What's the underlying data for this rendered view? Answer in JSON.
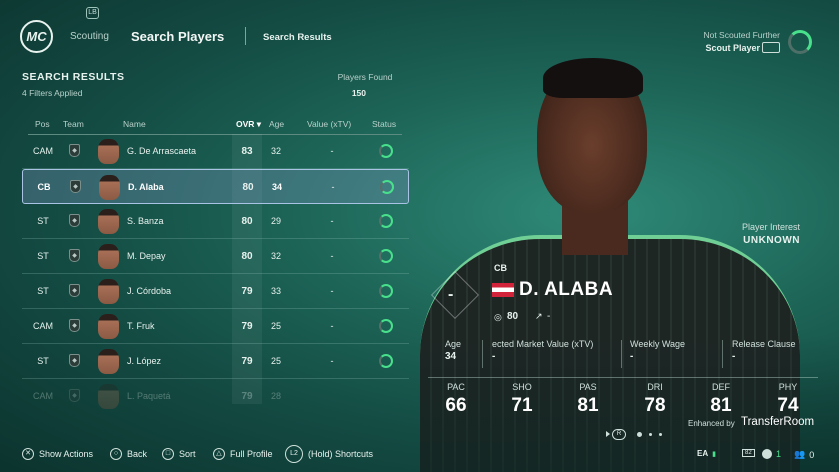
{
  "header": {
    "logo": "MC",
    "lb_badge": "LB",
    "nav_scouting": "Scouting",
    "nav_search_players": "Search Players",
    "nav_search_results": "Search Results",
    "not_scouted": "Not Scouted Further",
    "scout_player": "Scout Player"
  },
  "results": {
    "title": "SEARCH RESULTS",
    "filters": "4 Filters Applied",
    "players_found_label": "Players Found",
    "players_found_value": "150"
  },
  "columns": {
    "pos": "Pos",
    "team": "Team",
    "name": "Name",
    "ovr": "OVR ▾",
    "age": "Age",
    "value": "Value (xTV)",
    "status": "Status"
  },
  "rows": [
    {
      "pos": "CAM",
      "name": "G. De Arrascaeta",
      "ovr": "83",
      "age": "32",
      "value": "-"
    },
    {
      "pos": "CB",
      "name": "D. Alaba",
      "ovr": "80",
      "age": "34",
      "value": "-"
    },
    {
      "pos": "ST",
      "name": "S. Banza",
      "ovr": "80",
      "age": "29",
      "value": "-"
    },
    {
      "pos": "ST",
      "name": "M. Depay",
      "ovr": "80",
      "age": "32",
      "value": "-"
    },
    {
      "pos": "ST",
      "name": "J. Córdoba",
      "ovr": "79",
      "age": "33",
      "value": "-"
    },
    {
      "pos": "CAM",
      "name": "T. Fruk",
      "ovr": "79",
      "age": "25",
      "value": "-"
    },
    {
      "pos": "ST",
      "name": "J. López",
      "ovr": "79",
      "age": "25",
      "value": "-"
    },
    {
      "pos": "CAM",
      "name": "L. Paquetá",
      "ovr": "79",
      "age": "28",
      "value": "-"
    }
  ],
  "player": {
    "interest_label": "Player Interest",
    "interest_value": "UNKNOWN",
    "dash": "-",
    "position": "CB",
    "name": "D. ALABA",
    "ovr": "80",
    "trend": "-",
    "age_label": "Age",
    "age_value": "34",
    "market_label": "ected Market Value (xTV)",
    "market_value": "-",
    "wage_label": "Weekly Wage",
    "wage_value": "-",
    "release_label": "Release Clause",
    "release_value": "-",
    "stats": [
      {
        "label": "PAC",
        "value": "66"
      },
      {
        "label": "SHO",
        "value": "71"
      },
      {
        "label": "PAS",
        "value": "81"
      },
      {
        "label": "DRI",
        "value": "78"
      },
      {
        "label": "DEF",
        "value": "81"
      },
      {
        "label": "PHY",
        "value": "74"
      }
    ],
    "enhanced_by": "Enhanced by",
    "transferroom": "TransferRoom",
    "pager_current": "R"
  },
  "footer": {
    "show_actions": "Show Actions",
    "back": "Back",
    "sort": "Sort",
    "full_profile": "Full Profile",
    "shortcuts": "(Hold) Shortcuts",
    "ea_count": "1",
    "notif_count": "0"
  },
  "colors": {
    "accent_green": "#49e08c",
    "background": "#1d6557"
  }
}
